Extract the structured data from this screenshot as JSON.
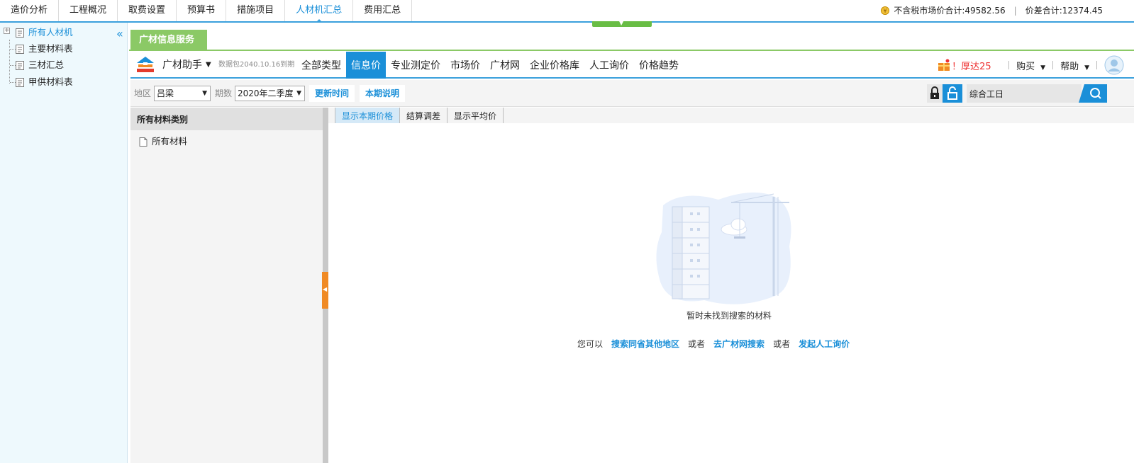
{
  "top_tabs": [
    {
      "label": "造价分析"
    },
    {
      "label": "工程概况"
    },
    {
      "label": "取费设置"
    },
    {
      "label": "预算书"
    },
    {
      "label": "措施项目"
    },
    {
      "label": "人材机汇总",
      "active": true
    },
    {
      "label": "费用汇总"
    }
  ],
  "totals": {
    "market_label": "不含税市场价合计:",
    "market_value": "49582.56",
    "diff_label": "价差合计:",
    "diff_value": "12374.45"
  },
  "sidebar": {
    "root": "所有人材机",
    "items": [
      "主要材料表",
      "三材汇总",
      "甲供材料表"
    ]
  },
  "service_tab": "广材信息服务",
  "toolbar": {
    "brand": "广材助手",
    "datapack": "数据包2040.10.16到期",
    "navs": [
      "全部类型",
      "信息价",
      "专业测定价",
      "市场价",
      "广材网",
      "企业价格库",
      "人工询价",
      "价格趋势"
    ],
    "active_nav": "信息价",
    "promo": "！厚达25",
    "buy": "购买",
    "help": "帮助"
  },
  "filters": {
    "region_label": "地区",
    "region_value": "吕梁",
    "period_label": "期数",
    "period_value": "2020年二季度",
    "update_time": "更新时间",
    "period_note": "本期说明",
    "search_value": "综合工日"
  },
  "category": {
    "header": "所有材料类别",
    "item": "所有材料"
  },
  "subtabs": [
    "显示本期价格",
    "结算调差",
    "显示平均价"
  ],
  "empty": {
    "message": "暂时未找到搜索的材料",
    "prefix": "您可以",
    "link1": "搜索同省其他地区",
    "or1": "或者",
    "link2": "去广材网搜索",
    "or2": "或者",
    "link3": "发起人工询价"
  },
  "colors": {
    "accent_blue": "#1a8fd8",
    "green": "#8bc966",
    "orange": "#f08a24"
  }
}
